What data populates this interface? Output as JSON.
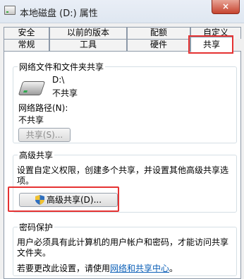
{
  "window": {
    "title": "本地磁盘 (D:) 属性",
    "close_symbol": "×"
  },
  "tabs": {
    "back_row": [
      "安全",
      "以前的版本",
      "配额",
      "自定义"
    ],
    "front_row": [
      "常规",
      "工具",
      "硬件",
      "共享"
    ],
    "selected": "共享"
  },
  "network_sharing": {
    "group_title": "网络文件和文件夹共享",
    "drive_name": "D:\\",
    "drive_status": "不共享",
    "path_label": "网络路径(N):",
    "path_value": "不共享",
    "share_button": "共享(S)..."
  },
  "advanced_sharing": {
    "group_title": "高级共享",
    "description_line1": "设置自定义权限，创建多个共享，并设置其他高级共享选",
    "description_line2": "项。",
    "button": "高级共享(D)..."
  },
  "password_protection": {
    "group_title": "密码保护",
    "description_line1": "用户必须具有此计算机的用户帐户和密码，才能访问共享",
    "description_line2": "文件夹。",
    "change_prefix": "若要更改此设置，请使用",
    "link_text": "网络和共享中心",
    "change_suffix": "。"
  },
  "colors": {
    "highlight": "#e53232",
    "link": "#0b5fb7"
  }
}
